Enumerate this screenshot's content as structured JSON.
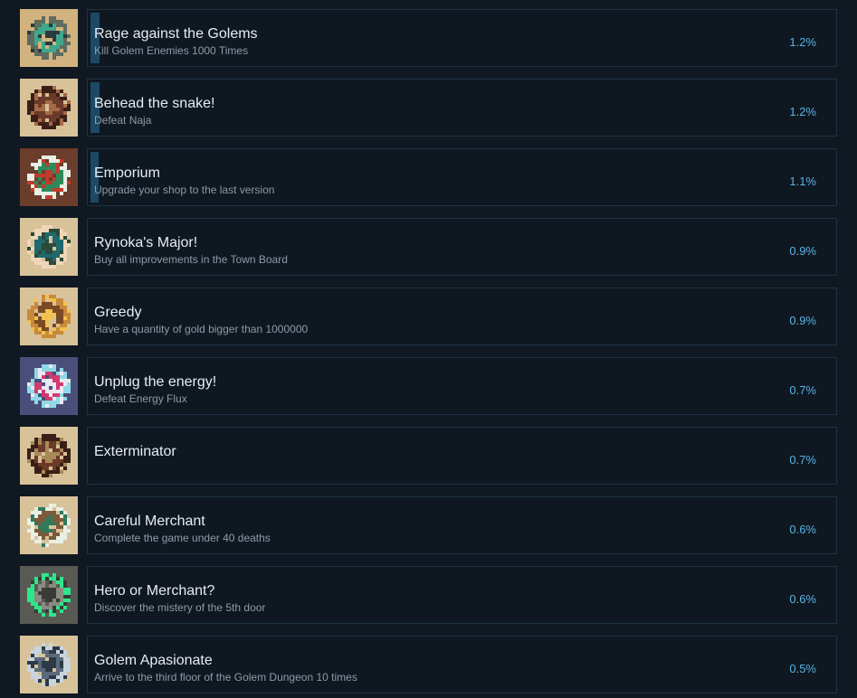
{
  "achievements": [
    {
      "title": "Rage against the Golems",
      "description": "Kill Golem Enemies 1000 Times",
      "percent_label": "1.2%",
      "progress": 0.012,
      "icon": "golem-rubble-icon",
      "icon_colors": [
        "#d2b37f",
        "#3fa88c",
        "#5e6b5d",
        "#2c3a3d"
      ]
    },
    {
      "title": "Behead the snake!",
      "description": "Defeat Naja",
      "percent_label": "1.2%",
      "progress": 0.012,
      "icon": "naja-snake-head-icon",
      "icon_colors": [
        "#d8c29a",
        "#6b3a28",
        "#3b1f17",
        "#a56a46"
      ]
    },
    {
      "title": "Emporium",
      "description": "Upgrade your shop to the last version",
      "percent_label": "1.1%",
      "progress": 0.011,
      "icon": "shop-banner-icon",
      "icon_colors": [
        "#6a3d2c",
        "#2e8a5a",
        "#e9efe4",
        "#c23b2a"
      ]
    },
    {
      "title": "Rynoka's Major!",
      "description": "Buy all improvements in the Town Board",
      "percent_label": "0.9%",
      "progress": 0.009,
      "icon": "mayor-top-hat-icon",
      "icon_colors": [
        "#d8c29a",
        "#1f6a6e",
        "#f0d6b8",
        "#2c4a3a"
      ]
    },
    {
      "title": "Greedy",
      "description": "Have a quantity of gold bigger than 1000000",
      "percent_label": "0.9%",
      "progress": 0.009,
      "icon": "gold-sack-icon",
      "icon_colors": [
        "#d8c29a",
        "#7a4a24",
        "#c88a3a",
        "#f2c14e"
      ]
    },
    {
      "title": "Unplug the energy!",
      "description": "Defeat Energy Flux",
      "percent_label": "0.7%",
      "progress": 0.007,
      "icon": "energy-flux-icon",
      "icon_colors": [
        "#4a4f7a",
        "#d23a6e",
        "#8fd9e6",
        "#e9e9f2"
      ]
    },
    {
      "title": "Exterminator",
      "description": "",
      "percent_label": "0.7%",
      "progress": 0.007,
      "icon": "exterminator-mallet-icon",
      "icon_colors": [
        "#d8c29a",
        "#6b3a28",
        "#3b1f17",
        "#a88a5a"
      ]
    },
    {
      "title": "Careful Merchant",
      "description": "Complete the game under 40 deaths",
      "percent_label": "0.6%",
      "progress": 0.006,
      "icon": "merchant-will-icon",
      "icon_colors": [
        "#d8c29a",
        "#7a5a3a",
        "#e9efe4",
        "#2e7a5a"
      ]
    },
    {
      "title": "Hero or Merchant?",
      "description": "Discover the mistery of the 5th door",
      "percent_label": "0.6%",
      "progress": 0.006,
      "icon": "green-portal-door-icon",
      "icon_colors": [
        "#5a5a55",
        "#8a8a80",
        "#2ee68a",
        "#3a3a36"
      ]
    },
    {
      "title": "Golem Apasionate",
      "description": "Arrive to the third floor of the Golem Dungeon 10 times",
      "percent_label": "0.5%",
      "progress": 0.005,
      "icon": "golem-statue-icon",
      "icon_colors": [
        "#d8c29a",
        "#5a6a7a",
        "#c9d4dc",
        "#2c3a48"
      ]
    }
  ]
}
